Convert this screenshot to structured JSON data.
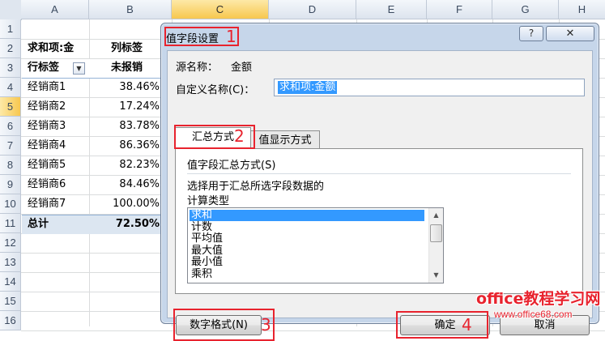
{
  "sheet": {
    "columns": [
      "A",
      "B",
      "C",
      "D",
      "E",
      "F",
      "G",
      "H"
    ],
    "selected_column": "C",
    "rows": [
      "1",
      "2",
      "3",
      "4",
      "5",
      "6",
      "7",
      "8",
      "9",
      "10",
      "11",
      "12",
      "13",
      "14",
      "15",
      "16"
    ],
    "selected_row": "5",
    "pivot": {
      "sum_label": "求和项:金",
      "col_label": "列标签",
      "row_label": "行标签",
      "col_value_head": "未报销",
      "items": [
        {
          "name": "经销商1",
          "value": "38.46%"
        },
        {
          "name": "经销商2",
          "value": "17.24%"
        },
        {
          "name": "经销商3",
          "value": "83.78%"
        },
        {
          "name": "经销商4",
          "value": "86.36%"
        },
        {
          "name": "经销商5",
          "value": "82.23%"
        },
        {
          "name": "经销商6",
          "value": "84.46%"
        },
        {
          "name": "经销商7",
          "value": "100.00%"
        }
      ],
      "total_label": "总计",
      "total_value": "72.50%"
    }
  },
  "dialog": {
    "title": "值字段设置",
    "help": "?",
    "close": "✕",
    "source_label": "源名称：",
    "source_value": "金额",
    "custom_label": "自定义名称(C)：",
    "custom_value": "求和项:金额",
    "tabs": [
      "汇总方式",
      "值显示方式"
    ],
    "group_title": "值字段汇总方式(S)",
    "desc_line1": "选择用于汇总所选字段数据的",
    "desc_line2": "计算类型",
    "functions": [
      "求和",
      "计数",
      "平均值",
      "最大值",
      "最小值",
      "乘积"
    ],
    "selected_function": "求和",
    "number_format_button": "数字格式(N)",
    "ok_button": "确定",
    "cancel_button": "取消"
  },
  "annotations": [
    "1",
    "2",
    "3",
    "4"
  ],
  "watermark": {
    "line1": "office教程学习网",
    "line2": "www.office68.com"
  },
  "colors": {
    "annotation_red": "#e8232e",
    "selection_blue": "#3399ff",
    "dialog_frame": "#c6d6ea",
    "header_selected": "#f7c74f"
  }
}
